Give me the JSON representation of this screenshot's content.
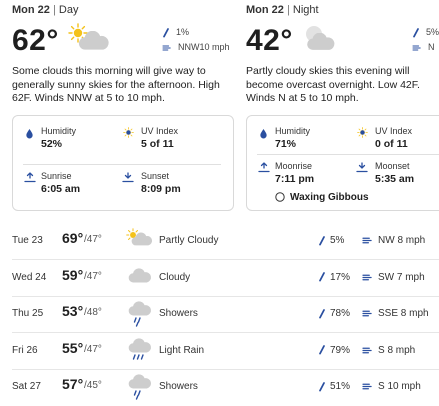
{
  "day": {
    "date": "Mon 22",
    "sep": "|",
    "period": "Day",
    "temp": "62°",
    "precip": "1%",
    "wind": "NNW10 mph",
    "desc": "Some clouds this morning will give way to generally sunny skies for the afternoon. High 62F. Winds NNW at 5 to 10 mph.",
    "humidity_label": "Humidity",
    "humidity": "52%",
    "uv_label": "UV Index",
    "uv": "5 of 11",
    "sunrise_label": "Sunrise",
    "sunrise": "6:05 am",
    "sunset_label": "Sunset",
    "sunset": "8:09 pm"
  },
  "night": {
    "date": "Mon 22",
    "sep": "|",
    "period": "Night",
    "temp": "42°",
    "precip": "5%",
    "wind": "N",
    "desc": "Partly cloudy skies this evening will become overcast overnight. Low 42F. Winds N at 5 to 10 mph.",
    "humidity_label": "Humidity",
    "humidity": "71%",
    "uv_label": "UV Index",
    "uv": "0 of 11",
    "moonrise_label": "Moonrise",
    "moonrise": "7:11 pm",
    "moonset_label": "Moonset",
    "moonset": "5:35 am",
    "moon_phase": "Waxing Gibbous"
  },
  "forecast": [
    {
      "day": "Tue 23",
      "hi": "69°",
      "lo": "/47°",
      "icon": "partly-cloudy-icon",
      "cond": "Partly Cloudy",
      "precip": "5%",
      "wind": "NW 8 mph"
    },
    {
      "day": "Wed 24",
      "hi": "59°",
      "lo": "/47°",
      "icon": "cloudy-icon",
      "cond": "Cloudy",
      "precip": "17%",
      "wind": "SW 7 mph"
    },
    {
      "day": "Thu 25",
      "hi": "53°",
      "lo": "/48°",
      "icon": "showers-icon",
      "cond": "Showers",
      "precip": "78%",
      "wind": "SSE 8 mph"
    },
    {
      "day": "Fri 26",
      "hi": "55°",
      "lo": "/47°",
      "icon": "rain-icon",
      "cond": "Light Rain",
      "precip": "79%",
      "wind": "S 8 mph"
    },
    {
      "day": "Sat 27",
      "hi": "57°",
      "lo": "/45°",
      "icon": "showers-icon",
      "cond": "Showers",
      "precip": "51%",
      "wind": "S 10 mph"
    }
  ],
  "colors": {
    "accent": "#2a4fa0",
    "sun": "#f4c21a",
    "cloud": "#c8c8c8",
    "border": "#d9d9d9"
  }
}
